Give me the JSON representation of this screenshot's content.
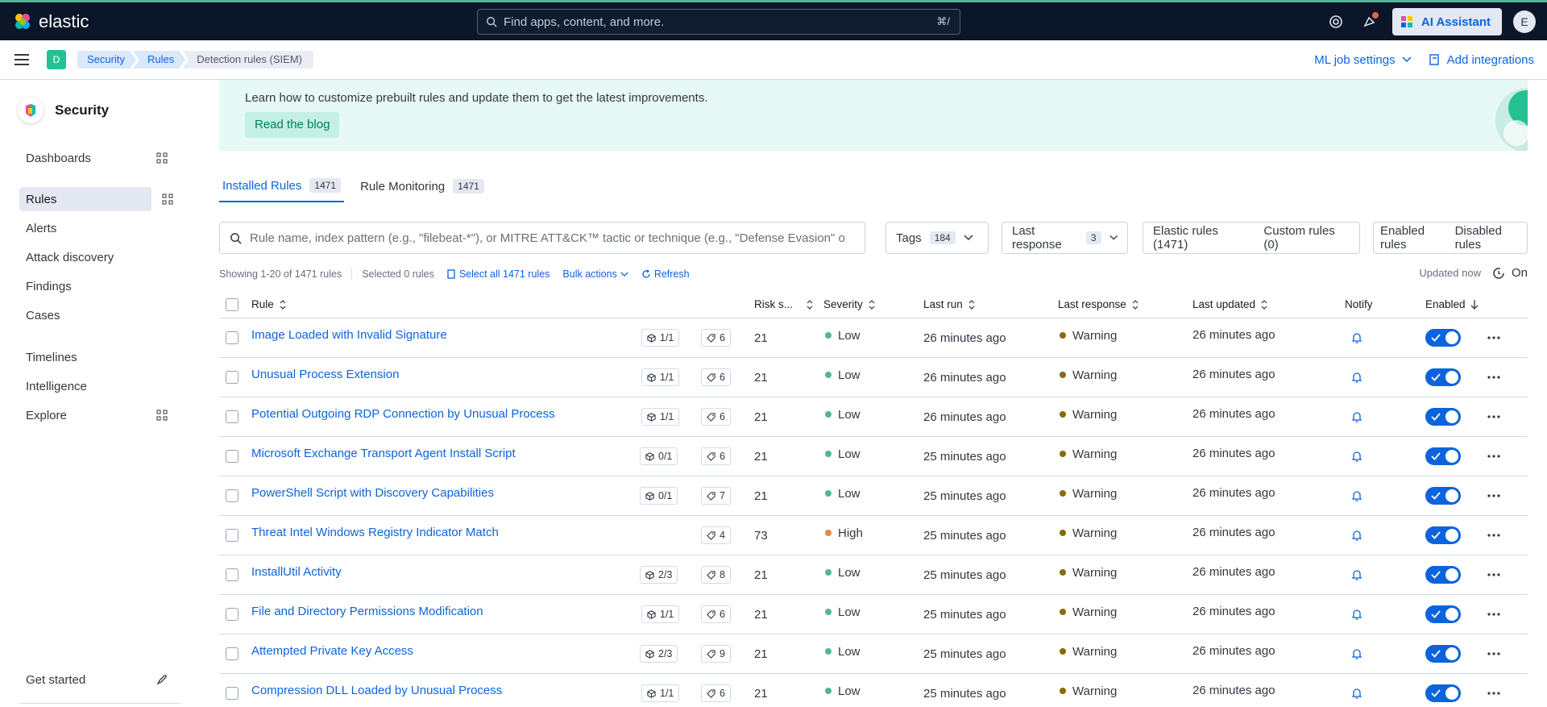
{
  "header": {
    "logo_text": "elastic",
    "search_placeholder": "Find apps, content, and more.",
    "search_shortcut": "⌘/",
    "ai_assistant_label": "AI Assistant",
    "user_initial": "E"
  },
  "subheader": {
    "space_initial": "D",
    "breadcrumbs": [
      "Security",
      "Rules",
      "Detection rules (SIEM)"
    ],
    "ml_job_settings": "ML job settings",
    "add_integrations": "Add integrations"
  },
  "sidebar": {
    "title": "Security",
    "items": [
      {
        "label": "Dashboards"
      },
      {
        "label": "Rules"
      },
      {
        "label": "Alerts"
      },
      {
        "label": "Attack discovery"
      },
      {
        "label": "Findings"
      },
      {
        "label": "Cases"
      },
      {
        "label": "Timelines"
      },
      {
        "label": "Intelligence"
      },
      {
        "label": "Explore"
      }
    ],
    "footer_label": "Get started"
  },
  "callout": {
    "text": "Learn how to customize prebuilt rules and update them to get the latest improvements.",
    "button": "Read the blog"
  },
  "tabs": [
    {
      "label": "Installed Rules",
      "count": "1471"
    },
    {
      "label": "Rule Monitoring",
      "count": "1471"
    }
  ],
  "filters": {
    "search_placeholder": "Rule name, index pattern (e.g., \"filebeat-*\"), or MITRE ATT&CK™ tactic or technique (e.g., \"Defense Evasion\" or \"",
    "tags_label": "Tags",
    "tags_count": "184",
    "last_response_label": "Last response",
    "last_response_count": "3",
    "elastic_rules": "Elastic rules (1471)",
    "custom_rules": "Custom rules (0)",
    "enabled_rules": "Enabled rules",
    "disabled_rules": "Disabled rules"
  },
  "toolbar": {
    "showing": "Showing 1-20 of 1471 rules",
    "selected": "Selected 0 rules",
    "select_all": "Select all 1471 rules",
    "bulk_actions": "Bulk actions",
    "refresh": "Refresh",
    "updated": "Updated now",
    "auto_refresh": "On"
  },
  "table": {
    "columns": [
      "Rule",
      "Risk s...",
      "Severity",
      "Last run",
      "Last response",
      "Last updated",
      "Notify",
      "Enabled"
    ],
    "rows": [
      {
        "name": "Image Loaded with Invalid Signature",
        "integrations": "1/1",
        "tags": "6",
        "risk": "21",
        "severity": "Low",
        "last_run": "26 minutes ago",
        "response": "Warning",
        "updated": "26 minutes ago"
      },
      {
        "name": "Unusual Process Extension",
        "integrations": "1/1",
        "tags": "6",
        "risk": "21",
        "severity": "Low",
        "last_run": "26 minutes ago",
        "response": "Warning",
        "updated": "26 minutes ago"
      },
      {
        "name": "Potential Outgoing RDP Connection by Unusual Process",
        "integrations": "1/1",
        "tags": "6",
        "risk": "21",
        "severity": "Low",
        "last_run": "26 minutes ago",
        "response": "Warning",
        "updated": "26 minutes ago"
      },
      {
        "name": "Microsoft Exchange Transport Agent Install Script",
        "integrations": "0/1",
        "tags": "6",
        "risk": "21",
        "severity": "Low",
        "last_run": "25 minutes ago",
        "response": "Warning",
        "updated": "26 minutes ago"
      },
      {
        "name": "PowerShell Script with Discovery Capabilities",
        "integrations": "0/1",
        "tags": "7",
        "risk": "21",
        "severity": "Low",
        "last_run": "25 minutes ago",
        "response": "Warning",
        "updated": "26 minutes ago"
      },
      {
        "name": "Threat Intel Windows Registry Indicator Match",
        "integrations": "",
        "tags": "4",
        "risk": "73",
        "severity": "High",
        "last_run": "25 minutes ago",
        "response": "Warning",
        "updated": "26 minutes ago"
      },
      {
        "name": "InstallUtil Activity",
        "integrations": "2/3",
        "tags": "8",
        "risk": "21",
        "severity": "Low",
        "last_run": "25 minutes ago",
        "response": "Warning",
        "updated": "26 minutes ago"
      },
      {
        "name": "File and Directory Permissions Modification",
        "integrations": "1/1",
        "tags": "6",
        "risk": "21",
        "severity": "Low",
        "last_run": "25 minutes ago",
        "response": "Warning",
        "updated": "26 minutes ago"
      },
      {
        "name": "Attempted Private Key Access",
        "integrations": "2/3",
        "tags": "9",
        "risk": "21",
        "severity": "Low",
        "last_run": "25 minutes ago",
        "response": "Warning",
        "updated": "26 minutes ago"
      },
      {
        "name": "Compression DLL Loaded by Unusual Process",
        "integrations": "1/1",
        "tags": "6",
        "risk": "21",
        "severity": "Low",
        "last_run": "25 minutes ago",
        "response": "Warning",
        "updated": "26 minutes ago"
      }
    ]
  },
  "colors": {
    "accent": "#0b64dd",
    "severity_low": "#54b399",
    "severity_high": "#da8b45",
    "warning": "#8a6a0a"
  }
}
